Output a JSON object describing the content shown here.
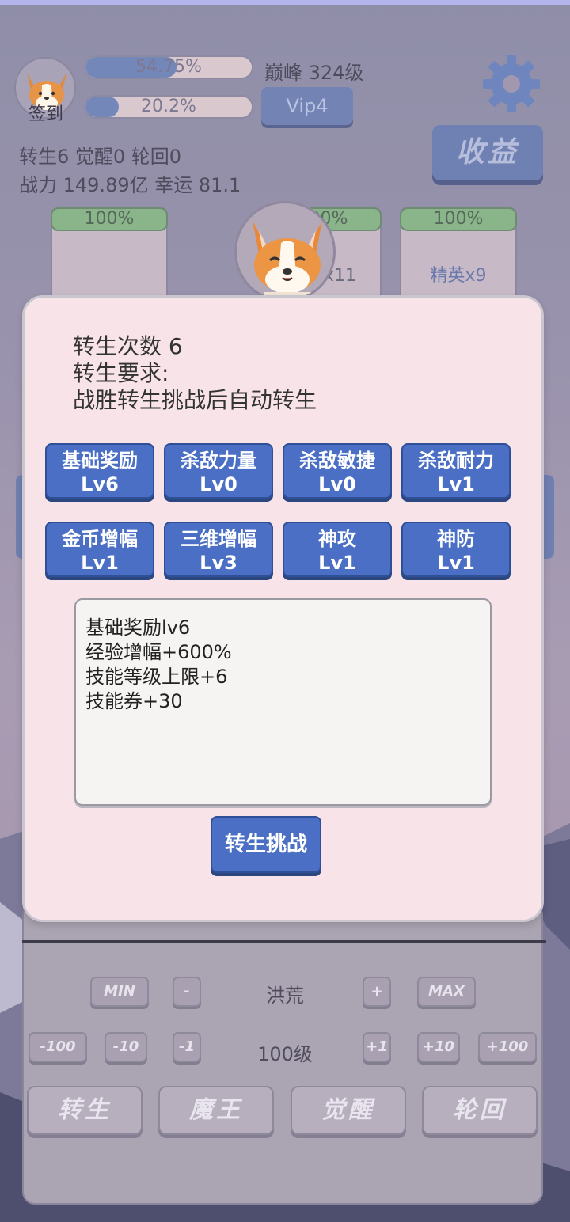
{
  "header": {
    "signin_label": "签到",
    "exp_bar": {
      "text": "54.75%",
      "progress": 0.5475
    },
    "second_bar": {
      "text": "20.2%",
      "progress": 0.202
    },
    "peak_level": "巅峰 324级",
    "vip_label": "Vip4",
    "income_label": "收益",
    "stats_line1": "转生6 觉醒0 轮回0",
    "stats_line2": "战力 149.89亿  幸运 81.1"
  },
  "cards": [
    {
      "pct": "100%",
      "label": ""
    },
    {
      "pct": "100%",
      "label": "怪x11"
    },
    {
      "pct": "100%",
      "label": "精英x9"
    }
  ],
  "modal": {
    "rebirth_count": "转生次数 6",
    "requirement_title": "转生要求:",
    "requirement_text": "战胜转生挑战后自动转生",
    "upgrades": [
      {
        "name": "基础奖励",
        "level": "Lv6"
      },
      {
        "name": "杀敌力量",
        "level": "Lv0"
      },
      {
        "name": "杀敌敏捷",
        "level": "Lv0"
      },
      {
        "name": "杀敌耐力",
        "level": "Lv1"
      },
      {
        "name": "金币增幅",
        "level": "Lv1"
      },
      {
        "name": "三维增幅",
        "level": "Lv3"
      },
      {
        "name": "神攻",
        "level": "Lv1"
      },
      {
        "name": "神防",
        "level": "Lv1"
      }
    ],
    "description_lines": [
      "基础奖励lv6",
      "经验增幅+600%",
      "技能等级上限+6",
      "技能券+30"
    ],
    "challenge_button": "转生挑战"
  },
  "controls": {
    "min": "MIN",
    "minus": "-",
    "zone": "洪荒",
    "plus": "+",
    "max": "MAX",
    "m100": "-100",
    "m10": "-10",
    "m1": "-1",
    "level": "100级",
    "p1": "+1",
    "p10": "+10",
    "p100": "+100"
  },
  "bottom_buttons": [
    "转生",
    "魔王",
    "觉醒",
    "轮回"
  ],
  "colors": {
    "accent_blue": "#4a6fc4",
    "modal_bg": "#f7e3e8",
    "progress_green": "#8ab58a"
  }
}
